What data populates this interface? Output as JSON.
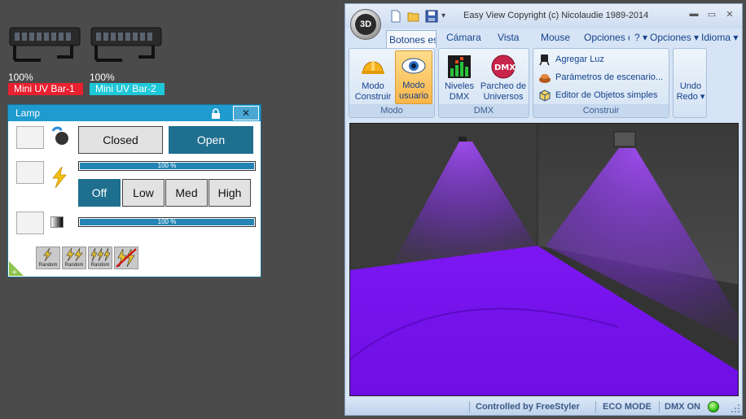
{
  "fixtures": [
    {
      "level": "100%",
      "name": "Mini UV Bar-1",
      "label_color": "#e8202f"
    },
    {
      "level": "100%",
      "name": "Mini UV Bar-2",
      "label_color": "#1ec8d8"
    }
  ],
  "lamp": {
    "title": "Lamp",
    "close_label": "✕",
    "shutter": {
      "closed": "Closed",
      "open": "Open",
      "selected": "Open"
    },
    "strobe_bar": {
      "text": "100 %",
      "value": 1.0
    },
    "speed": {
      "off": "Off",
      "low": "Low",
      "med": "Med",
      "high": "High",
      "selected": "Off"
    },
    "dimmer_bar": {
      "text": "100 %",
      "value": 1.0
    },
    "random_buttons": [
      "Random",
      "Random",
      "Random"
    ]
  },
  "app": {
    "title": "Easy View   Copyright (c) Nicolaudie 1989-2014",
    "orb_label": "3D",
    "tabs": [
      {
        "label": "Botones es",
        "selected": true
      },
      {
        "label": "Cámara"
      },
      {
        "label": "Vista"
      },
      {
        "label": "Mouse"
      },
      {
        "label": "Opciones c"
      },
      {
        "label": "? ▾"
      },
      {
        "label": "Opciones ▾"
      },
      {
        "label": "Idioma ▾"
      }
    ],
    "ribbon": {
      "modo": {
        "label": "Modo",
        "construir": "Modo Construir",
        "usuario": "Modo usuario"
      },
      "dmx": {
        "label": "DMX",
        "niveles": "Niveles DMX",
        "parcheo": "Parcheo de Universos"
      },
      "construir": {
        "label": "Construir",
        "agregar": "Agregar Luz",
        "parametros": "Parámetros de escenario...",
        "editor": "Editor de Objetos simples"
      },
      "undo": "Undo Redo ▾"
    },
    "status": {
      "controlled": "Controlled by FreeStyler",
      "eco": "ECO MODE",
      "dmx": "DMX ON"
    },
    "colors": {
      "uv": "#7a10f0",
      "accent": "#1f6f8f"
    }
  }
}
